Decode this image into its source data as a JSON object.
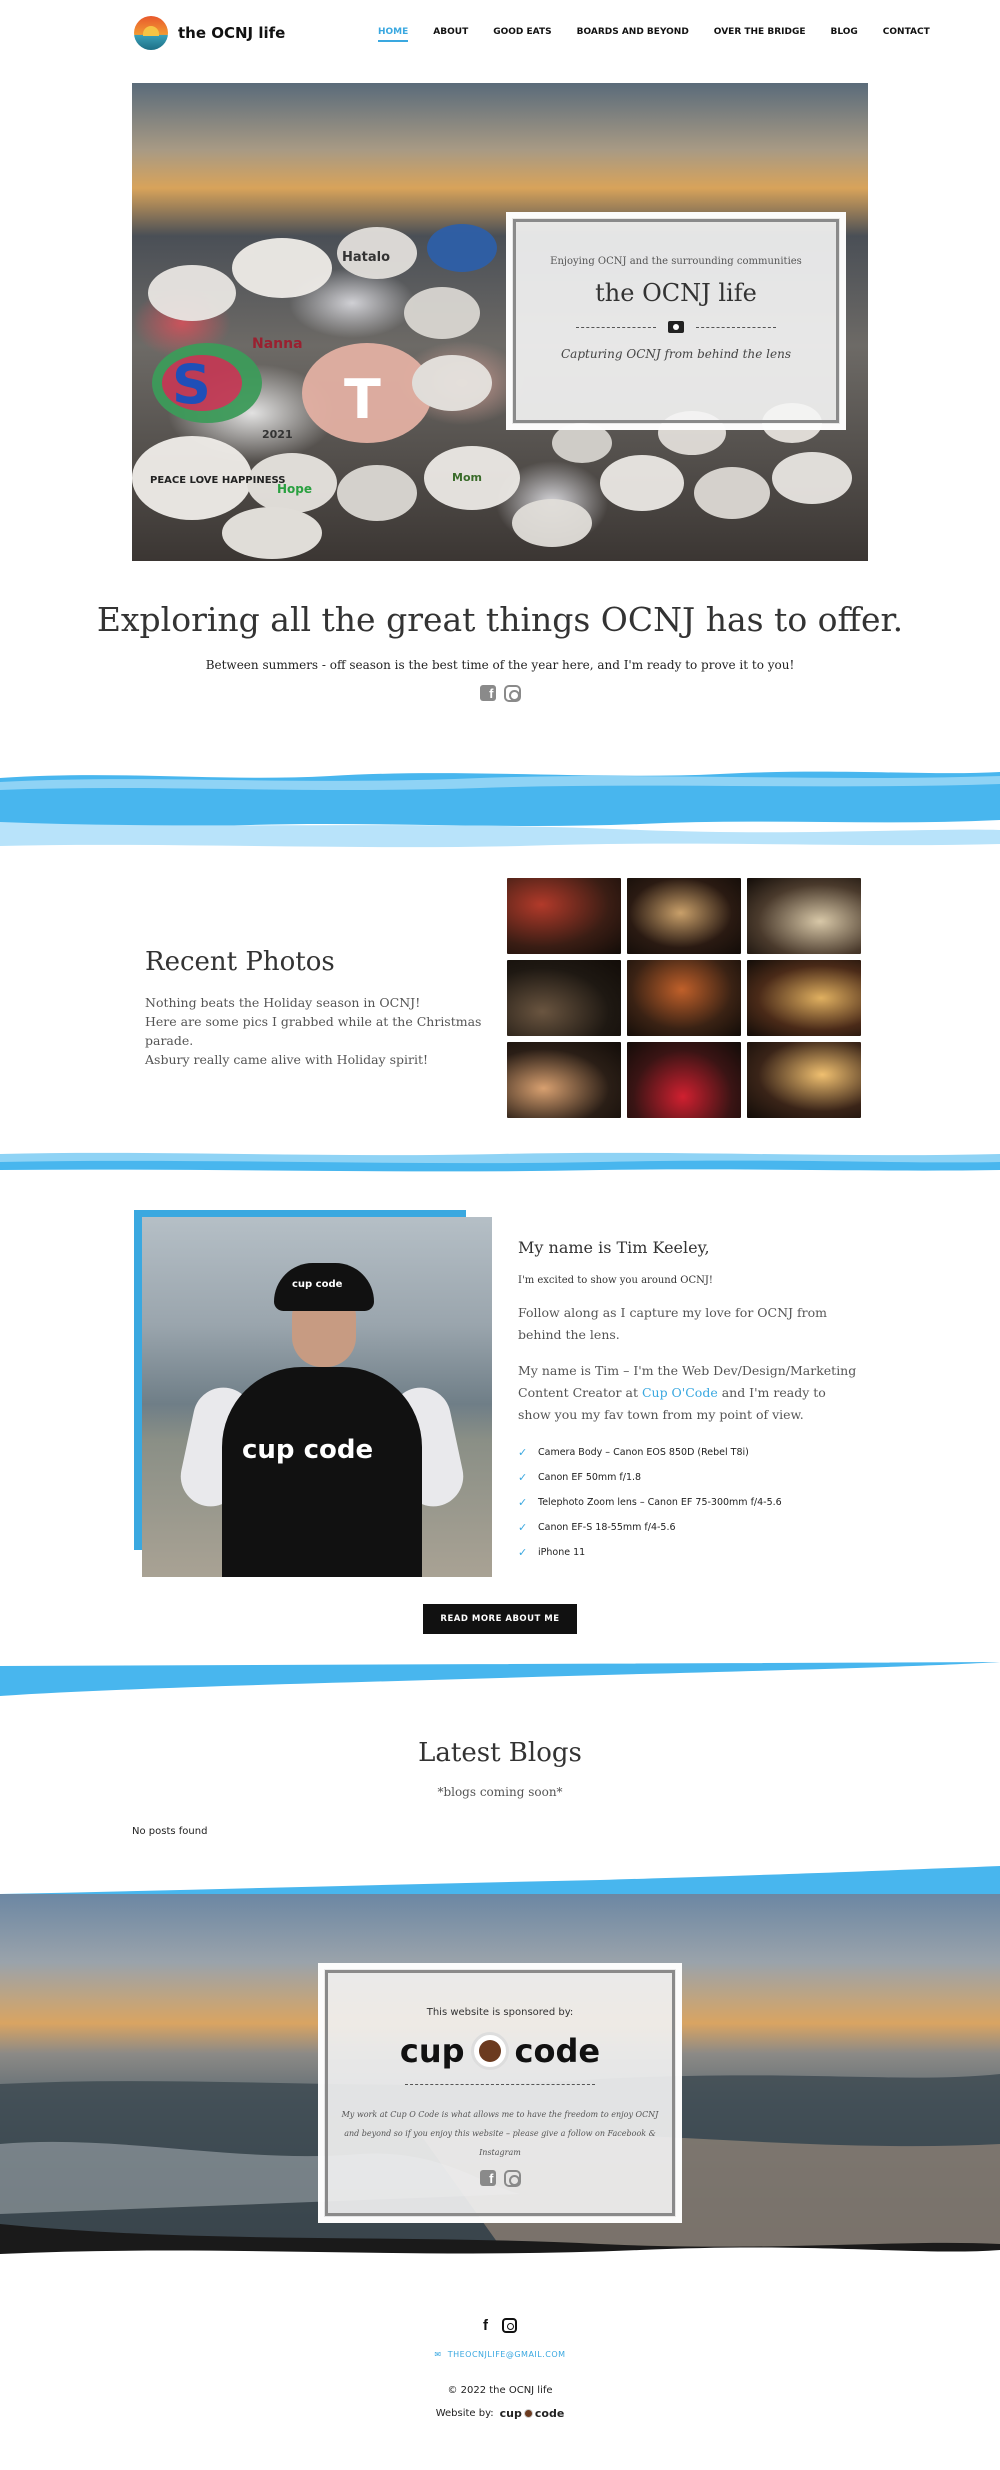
{
  "site": {
    "name": "the OCNJ life"
  },
  "nav": {
    "items": [
      {
        "label": "HOME"
      },
      {
        "label": "ABOUT"
      },
      {
        "label": "GOOD EATS"
      },
      {
        "label": "BOARDS AND BEYOND"
      },
      {
        "label": "OVER THE BRIDGE"
      },
      {
        "label": "BLOG"
      },
      {
        "label": "CONTACT"
      }
    ],
    "active": "HOME"
  },
  "hero": {
    "kicker": "Enjoying OCNJ and the surrounding communities",
    "title": "the OCNJ life",
    "tagline": "Capturing OCNJ from behind the lens",
    "painted_texts": [
      "S",
      "T",
      "Hatalo",
      "Nanna",
      "2021",
      "PEACE LOVE HAPPINESS",
      "Hope",
      "Mom"
    ]
  },
  "intro": {
    "title": "Exploring all the great things OCNJ has to offer.",
    "subtitle": "Between summers - off season is the best time of the year here, and I'm ready to prove it to you!"
  },
  "recent": {
    "title": "Recent Photos",
    "lines": [
      "Nothing beats the Holiday season in OCNJ!",
      "Here are some pics I grabbed while at the Christmas parade.",
      "Asbury really came alive with Holiday spirit!"
    ],
    "photos": [
      {
        "color": "#3a1d14",
        "accent": "#b23a2a"
      },
      {
        "color": "#2a1a12",
        "accent": "#c9a06a"
      },
      {
        "color": "#4a3a2c",
        "accent": "#d8c8a8"
      },
      {
        "color": "#1e1812",
        "accent": "#6a5540"
      },
      {
        "color": "#3a2214",
        "accent": "#c0602a"
      },
      {
        "color": "#4a2a18",
        "accent": "#e0b060"
      },
      {
        "color": "#2a1e16",
        "accent": "#d8a070"
      },
      {
        "color": "#3a1414",
        "accent": "#d02030"
      },
      {
        "color": "#3a2418",
        "accent": "#f0c070"
      }
    ]
  },
  "about": {
    "name": "My name is Tim Keeley,",
    "intro": "I'm excited to show you around OCNJ!",
    "follow": "Follow along as I capture my love for OCNJ from behind the lens.",
    "bio_before": "My name is Tim – I'm the Web Dev/Design/Marketing Content Creator at ",
    "bio_link": "Cup O'Code",
    "bio_after": " and I'm ready to show you my fav town from my point of view.",
    "gear": [
      "Camera Body – Canon EOS 850D (Rebel T8i)",
      "Canon EF 50mm f/1.8",
      "Telephoto Zoom lens – Canon EF 75-300mm f/4-5.6",
      "Canon EF-S 18-55mm f/4-5.6",
      "iPhone 11"
    ],
    "button": "READ MORE ABOUT ME",
    "shirt_text": "cup code",
    "hat_text": "cup code"
  },
  "blogs": {
    "title": "Latest Blogs",
    "subtitle": "*blogs coming soon*",
    "empty": "No posts found"
  },
  "sponsor": {
    "label": "This website is sponsored by:",
    "brand_left": "cup",
    "brand_right": "code",
    "message": "My work at Cup O Code is what allows me to have the freedom to enjoy OCNJ and beyond so if you enjoy this website – please give a follow on Facebook & Instagram"
  },
  "footer": {
    "email": "THEOCNJLIFE@GMAIL.COM",
    "copyright": "© 2022 the OCNJ life",
    "credit": "Website by:",
    "credit_left": "cup",
    "credit_right": "code"
  },
  "colors": {
    "accent": "#3aa8e0",
    "dark": "#111111"
  },
  "icons": [
    "facebook-icon",
    "instagram-icon",
    "camera-icon",
    "check-icon",
    "mail-icon"
  ]
}
